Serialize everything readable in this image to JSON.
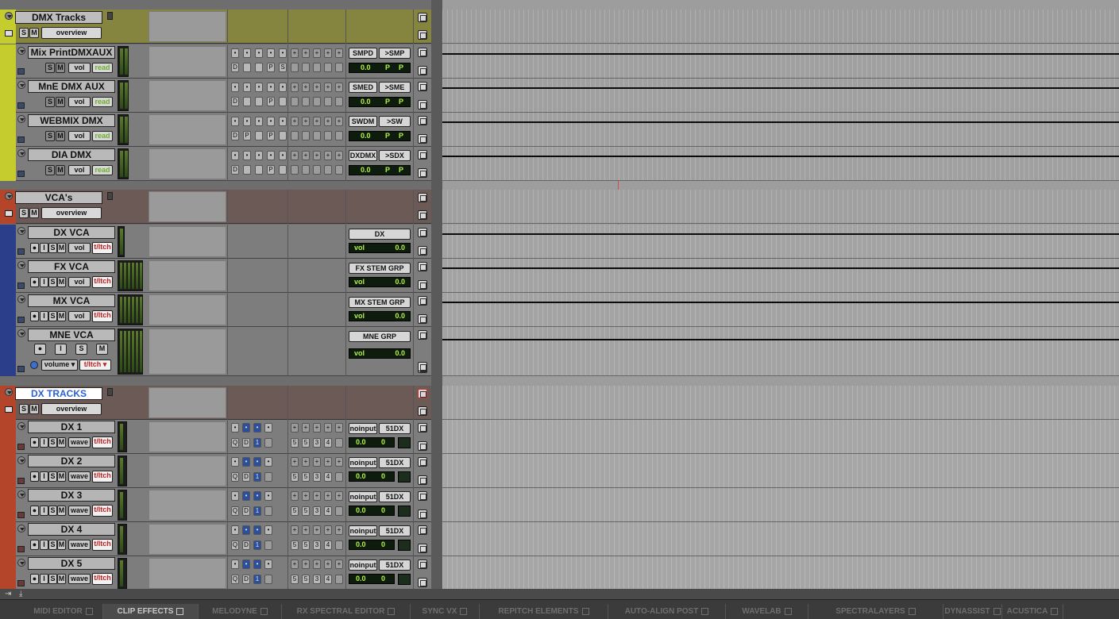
{
  "folders": [
    {
      "name": "DMX Tracks",
      "overview": "overview",
      "solo": "S",
      "mute": "M"
    },
    {
      "name": "VCA's",
      "overview": "overview",
      "solo": "S",
      "mute": "M"
    },
    {
      "name": "DX TRACKS",
      "overview": "overview",
      "solo": "S",
      "mute": "M"
    }
  ],
  "aux_tracks": [
    {
      "name": "Mix PrintDMXAUX",
      "view": "vol",
      "mode": "read",
      "io_in": "SMPD",
      "io_out": ">SMP",
      "ins": [
        "D",
        "",
        "",
        "P",
        "S"
      ],
      "vol": "0.0",
      "p1": "P",
      "p2": "P"
    },
    {
      "name": "MnE DMX AUX",
      "view": "vol",
      "mode": "read",
      "io_in": "SMED",
      "io_out": ">SME",
      "ins": [
        "D",
        "",
        "",
        "P",
        ""
      ],
      "vol": "0.0",
      "p1": "P",
      "p2": "P"
    },
    {
      "name": "WEBMIX DMX",
      "view": "vol",
      "mode": "read",
      "io_in": "SWDM",
      "io_out": ">SW",
      "ins": [
        "D",
        "P",
        "",
        "P",
        ""
      ],
      "vol": "0.0",
      "p1": "P",
      "p2": "P"
    },
    {
      "name": "DIA DMX",
      "view": "vol",
      "mode": "read",
      "io_in": "DXDMX",
      "io_out": ">SDX",
      "ins": [
        "D",
        "",
        "",
        "P",
        ""
      ],
      "vol": "0.0",
      "p1": "P",
      "p2": "P"
    }
  ],
  "vca_tracks": [
    {
      "name": "DX VCA",
      "view": "vol",
      "mode": "t/ltch",
      "group": "DX",
      "vol_label": "vol",
      "vol": "0.0"
    },
    {
      "name": "FX VCA",
      "view": "vol",
      "mode": "t/ltch",
      "group": "FX STEM GRP",
      "vol_label": "vol",
      "vol": "0.0"
    },
    {
      "name": "MX VCA",
      "view": "vol",
      "mode": "t/ltch",
      "group": "MX STEM GRP",
      "vol_label": "vol",
      "vol": "0.0"
    },
    {
      "name": "MNE VCA",
      "view": "volume",
      "mode": "t/ltch",
      "group": "MNE GRP",
      "vol_label": "vol",
      "vol": "0.0"
    }
  ],
  "dx_tracks": [
    {
      "name": "DX 1",
      "view": "wave",
      "mode": "t/ltch",
      "io_in": "noinput",
      "io_out": "51DX",
      "vol": "0.0",
      "pan": "0"
    },
    {
      "name": "DX 2",
      "view": "wave",
      "mode": "t/ltch",
      "io_in": "noinput",
      "io_out": "51DX",
      "vol": "0.0",
      "pan": "0"
    },
    {
      "name": "DX 3",
      "view": "wave",
      "mode": "t/ltch",
      "io_in": "noinput",
      "io_out": "51DX",
      "vol": "0.0",
      "pan": "0"
    },
    {
      "name": "DX 4",
      "view": "wave",
      "mode": "t/ltch",
      "io_in": "noinput",
      "io_out": "51DX",
      "vol": "0.0",
      "pan": "0"
    },
    {
      "name": "DX 5",
      "view": "wave",
      "mode": "t/ltch",
      "io_in": "noinput",
      "io_out": "51DX",
      "vol": "0.0",
      "pan": "0"
    }
  ],
  "dx_ins": [
    "Q",
    "D",
    "1"
  ],
  "dx_sends": [
    "5",
    "5",
    "3",
    "4"
  ],
  "vca_rec_labels": {
    "rec": "",
    "input": "I",
    "solo": "S",
    "mute": "M"
  },
  "bottom_tabs": [
    {
      "label": "MIDI EDITOR",
      "active": false
    },
    {
      "label": "CLIP EFFECTS",
      "active": true
    },
    {
      "label": "MELODYNE",
      "active": false
    },
    {
      "label": "RX SPECTRAL EDITOR",
      "active": false
    },
    {
      "label": "SYNC VX",
      "active": false
    },
    {
      "label": "REPITCH ELEMENTS",
      "active": false
    },
    {
      "label": "AUTO-ALIGN POST",
      "active": false
    },
    {
      "label": "WAVELAB",
      "active": false
    },
    {
      "label": "SPECTRALAYERS",
      "active": false
    },
    {
      "label": "DYNASSIST",
      "active": false
    },
    {
      "label": "ACUSTICA",
      "active": false
    }
  ],
  "colors": {
    "dmx": "#c5cc2e",
    "vca_folder": "#b5452a",
    "vca_track": "#2b3e8a",
    "dx": "#b5452a",
    "track_bg": "#7f7f7f",
    "timeline": "#a2a2a2"
  }
}
